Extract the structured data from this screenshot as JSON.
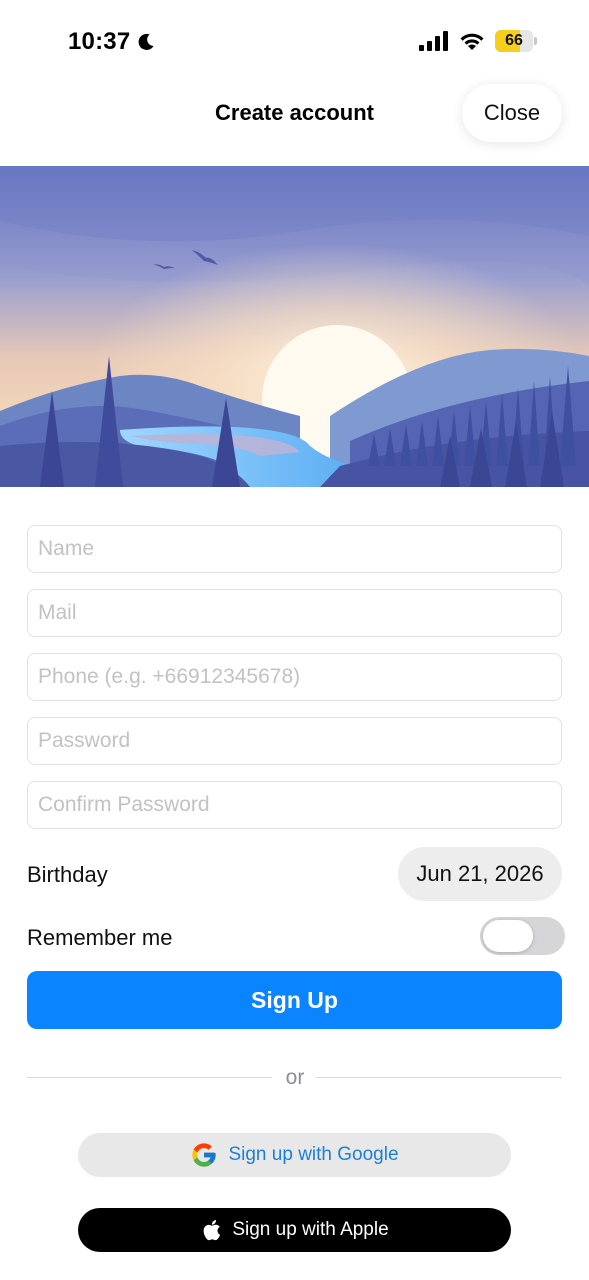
{
  "status_bar": {
    "time": "10:37",
    "battery_percent": "66",
    "battery_level": 0.66
  },
  "header": {
    "title": "Create account",
    "close_label": "Close"
  },
  "form": {
    "name_placeholder": "Name",
    "mail_placeholder": "Mail",
    "phone_placeholder": "Phone (e.g. +66912345678)",
    "password_placeholder": "Password",
    "confirm_password_placeholder": "Confirm Password",
    "birthday_label": "Birthday",
    "birthday_value": "Jun 21, 2026",
    "remember_label": "Remember me",
    "remember_on": false,
    "signup_label": "Sign Up",
    "or_text": "or",
    "google_label": "Sign up with Google",
    "apple_label": "Sign up with Apple"
  },
  "colors": {
    "accent": "#0a84ff",
    "google_text": "#1e7fd6",
    "battery": "#f5cf1c"
  }
}
